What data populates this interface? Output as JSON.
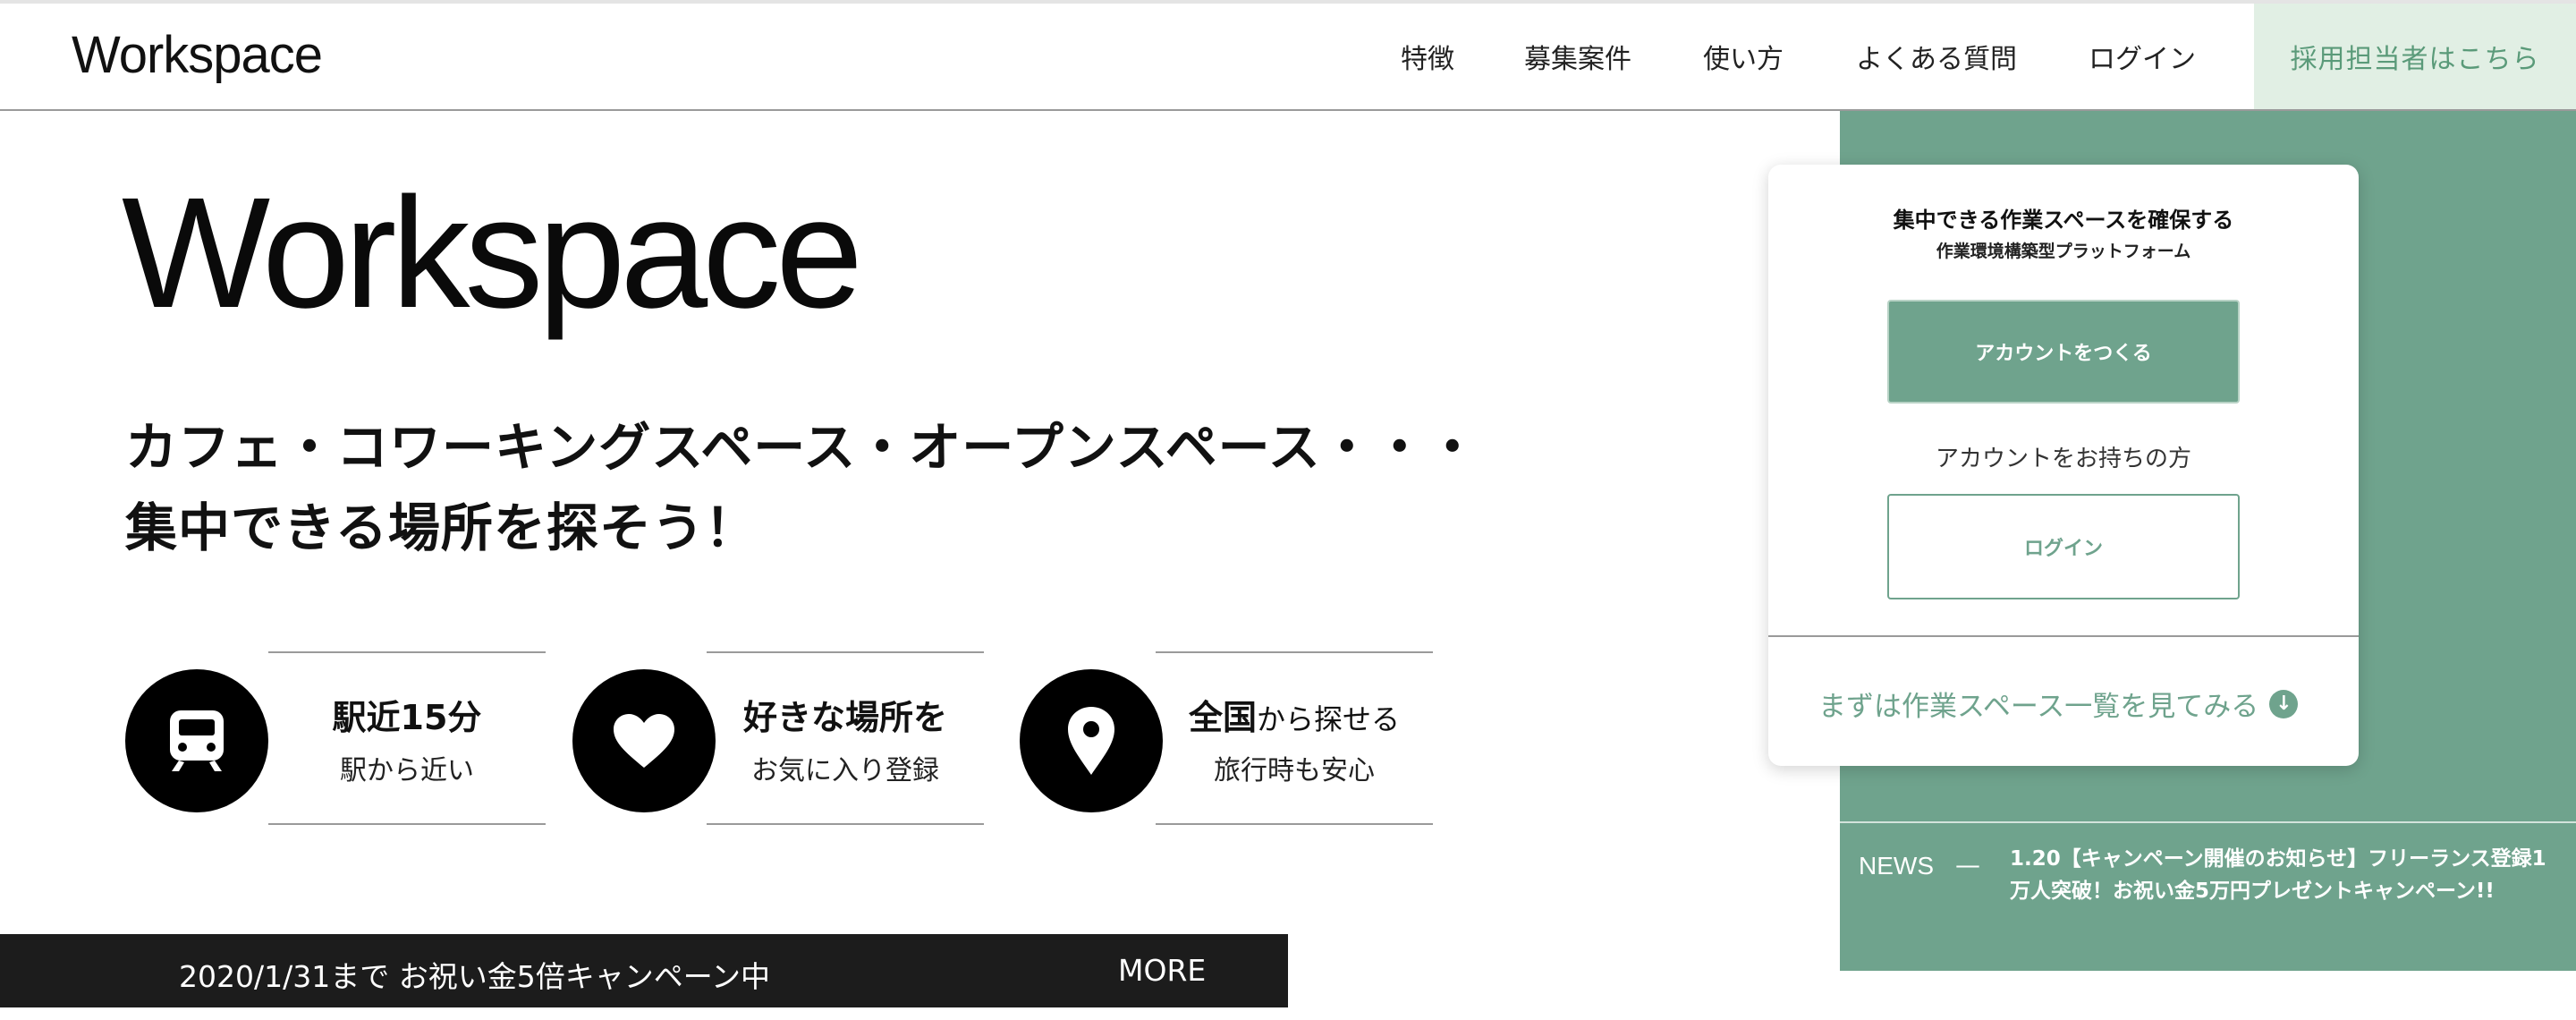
{
  "header": {
    "logo": "Workspace",
    "nav": [
      "特徴",
      "募集案件",
      "使い方",
      "よくある質問",
      "ログイン"
    ],
    "recruiter_link": "採用担当者はこちら"
  },
  "hero": {
    "title": "Workspace",
    "tagline_line1": "カフェ・コワーキングスペース・オープンスペース・・・",
    "tagline_line2": "集中できる場所を探そう！"
  },
  "features": [
    {
      "icon": "train-icon",
      "title": "駅近15分",
      "title_suffix": "",
      "subtitle": "駅から近い"
    },
    {
      "icon": "heart-icon",
      "title": "好きな場所を",
      "title_suffix": "",
      "subtitle": "お気に入り登録"
    },
    {
      "icon": "location-pin-icon",
      "title": "全国",
      "title_suffix": "から探せる",
      "subtitle": "旅行時も安心"
    }
  ],
  "campaign": {
    "text": "2020/1/31まで お祝い金5倍キャンペーン中",
    "more": "MORE"
  },
  "signup": {
    "title": "集中できる作業スペースを確保する",
    "subtitle": "作業環境構築型プラットフォーム",
    "create_button": "アカウントをつくる",
    "have_account": "アカウントをお持ちの方",
    "login_button": "ログイン",
    "view_list": "まずは作業スペース一覧を見てみる"
  },
  "news": {
    "label": "NEWS",
    "dash": "—",
    "text": "1.20【キャンペーン開催のお知らせ】フリーランス登録1万人突破！お祝い金5万円プレゼントキャンペーン!!"
  },
  "colors": {
    "accent": "#6fa38d",
    "accent_light": "#e1efe4",
    "dark_bar": "#1c1c1c"
  }
}
